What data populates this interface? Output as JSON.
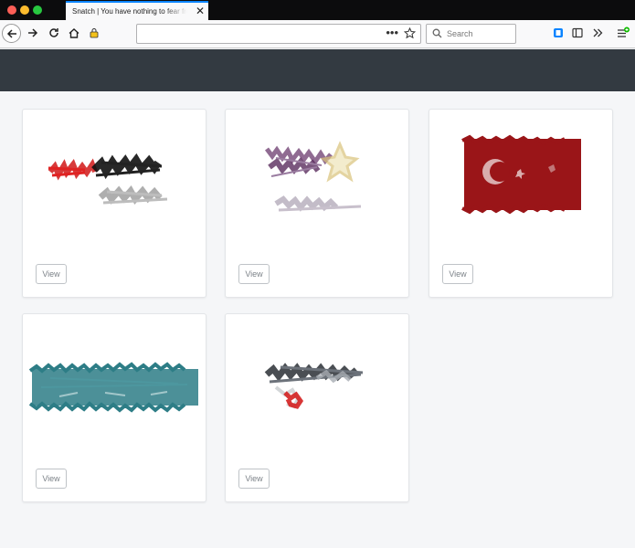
{
  "browser": {
    "tab_title": "Snatch | You have nothing to fear from me",
    "url": "",
    "url_more_label": "•••",
    "search_placeholder": "Search"
  },
  "cards": [
    {
      "view_label": "View",
      "image": "scribble-flag-red-black-gray"
    },
    {
      "view_label": "View",
      "image": "scribble-flag-purple-gold"
    },
    {
      "view_label": "View",
      "image": "scribble-flag-red-white-crescent"
    },
    {
      "view_label": "View",
      "image": "scribble-flag-teal"
    },
    {
      "view_label": "View",
      "image": "scribble-flag-black-gray-red"
    }
  ],
  "colors": {
    "header": "#333a41",
    "tab_accent": "#0a84ff",
    "page_bg": "#f5f6f8"
  }
}
